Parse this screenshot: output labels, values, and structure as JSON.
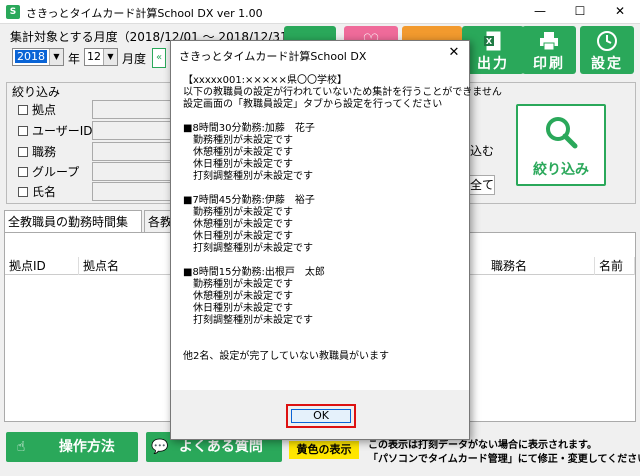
{
  "window": {
    "title": "さきっとタイムカード計算School DX  ver 1.00",
    "minimize": "—",
    "maximize": "☐",
    "close": "✕"
  },
  "period": {
    "label": "集計対象とする月度（2018/12/01 〜 2018/12/31）",
    "year_value": "2018",
    "year_unit": "年",
    "month_value": "12",
    "month_unit": "月度",
    "prev_label": "«"
  },
  "toolbar": {
    "output_label": "出力",
    "print_label": "印刷",
    "settings_label": "設定"
  },
  "filter": {
    "group_label": "絞り込み",
    "items": [
      {
        "label": "拠点"
      },
      {
        "label": "ユーザーID"
      },
      {
        "label": "職務"
      },
      {
        "label": "グループ"
      },
      {
        "label": "氏名"
      }
    ],
    "include_label": "込む",
    "all_button_label": "全て",
    "filter_button_label": "絞り込み"
  },
  "tabs": [
    {
      "label": "全教職員の勤務時間集計"
    },
    {
      "label": "各教"
    }
  ],
  "grid": {
    "columns": [
      "拠点ID",
      "拠点名",
      "職務名",
      "名前"
    ]
  },
  "bottom": {
    "howto_label": "操作方法",
    "faq_label": "よくある質問",
    "yellow_label": "黄色の表示",
    "note_line1": "この表示は打刻データがない場合に表示されます。",
    "note_line2": "「パソコンでタイムカード管理」にて修正・変更してください。"
  },
  "dialog": {
    "title": "さきっとタイムカード計算School DX",
    "close": "✕",
    "lines": [
      "【xxxxx001:×××××県〇〇学校】",
      "以下の教職員の設定が行われていないため集計を行うことができません",
      "設定画面の「教職員設定」タブから設定を行ってください",
      "",
      "■8時間30分勤務:加藤　花子",
      "　勤務種別が未設定です",
      "　休憩種別が未設定です",
      "　休日種別が未設定です",
      "　打刻調整種別が未設定です",
      "",
      "■7時間45分勤務:伊藤　裕子",
      "　勤務種別が未設定です",
      "　休憩種別が未設定です",
      "　休日種別が未設定です",
      "　打刻調整種別が未設定です",
      "",
      "■8時間15分勤務:出根戸　太郎",
      "　勤務種別が未設定です",
      "　休憩種別が未設定です",
      "　休日種別が未設定です",
      "　打刻調整種別が未設定です",
      "",
      "",
      "他2名、設定が完了していない教職員がいます"
    ],
    "ok_label": "OK"
  },
  "colors": {
    "green": "#2aa85a",
    "pink": "#ef6b9a",
    "orange": "#f29a2e",
    "yellow": "#ffe600",
    "ok_highlight": "#d11111"
  }
}
